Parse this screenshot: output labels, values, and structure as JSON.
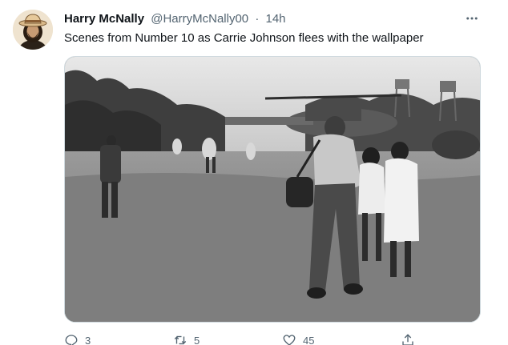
{
  "author": {
    "display_name": "Harry McNally",
    "handle": "@HarryMcNally00",
    "separator": "·",
    "time": "14h"
  },
  "tweet": {
    "text": "Scenes from Number 10 as Carrie Johnson flees with the wallpaper"
  },
  "media": {
    "icon": "photo"
  },
  "actions": {
    "reply_count": "3",
    "retweet_count": "5",
    "like_count": "45"
  },
  "colors": {
    "text_primary": "#0f1419",
    "text_secondary": "#536471",
    "border": "#cfd9de"
  }
}
